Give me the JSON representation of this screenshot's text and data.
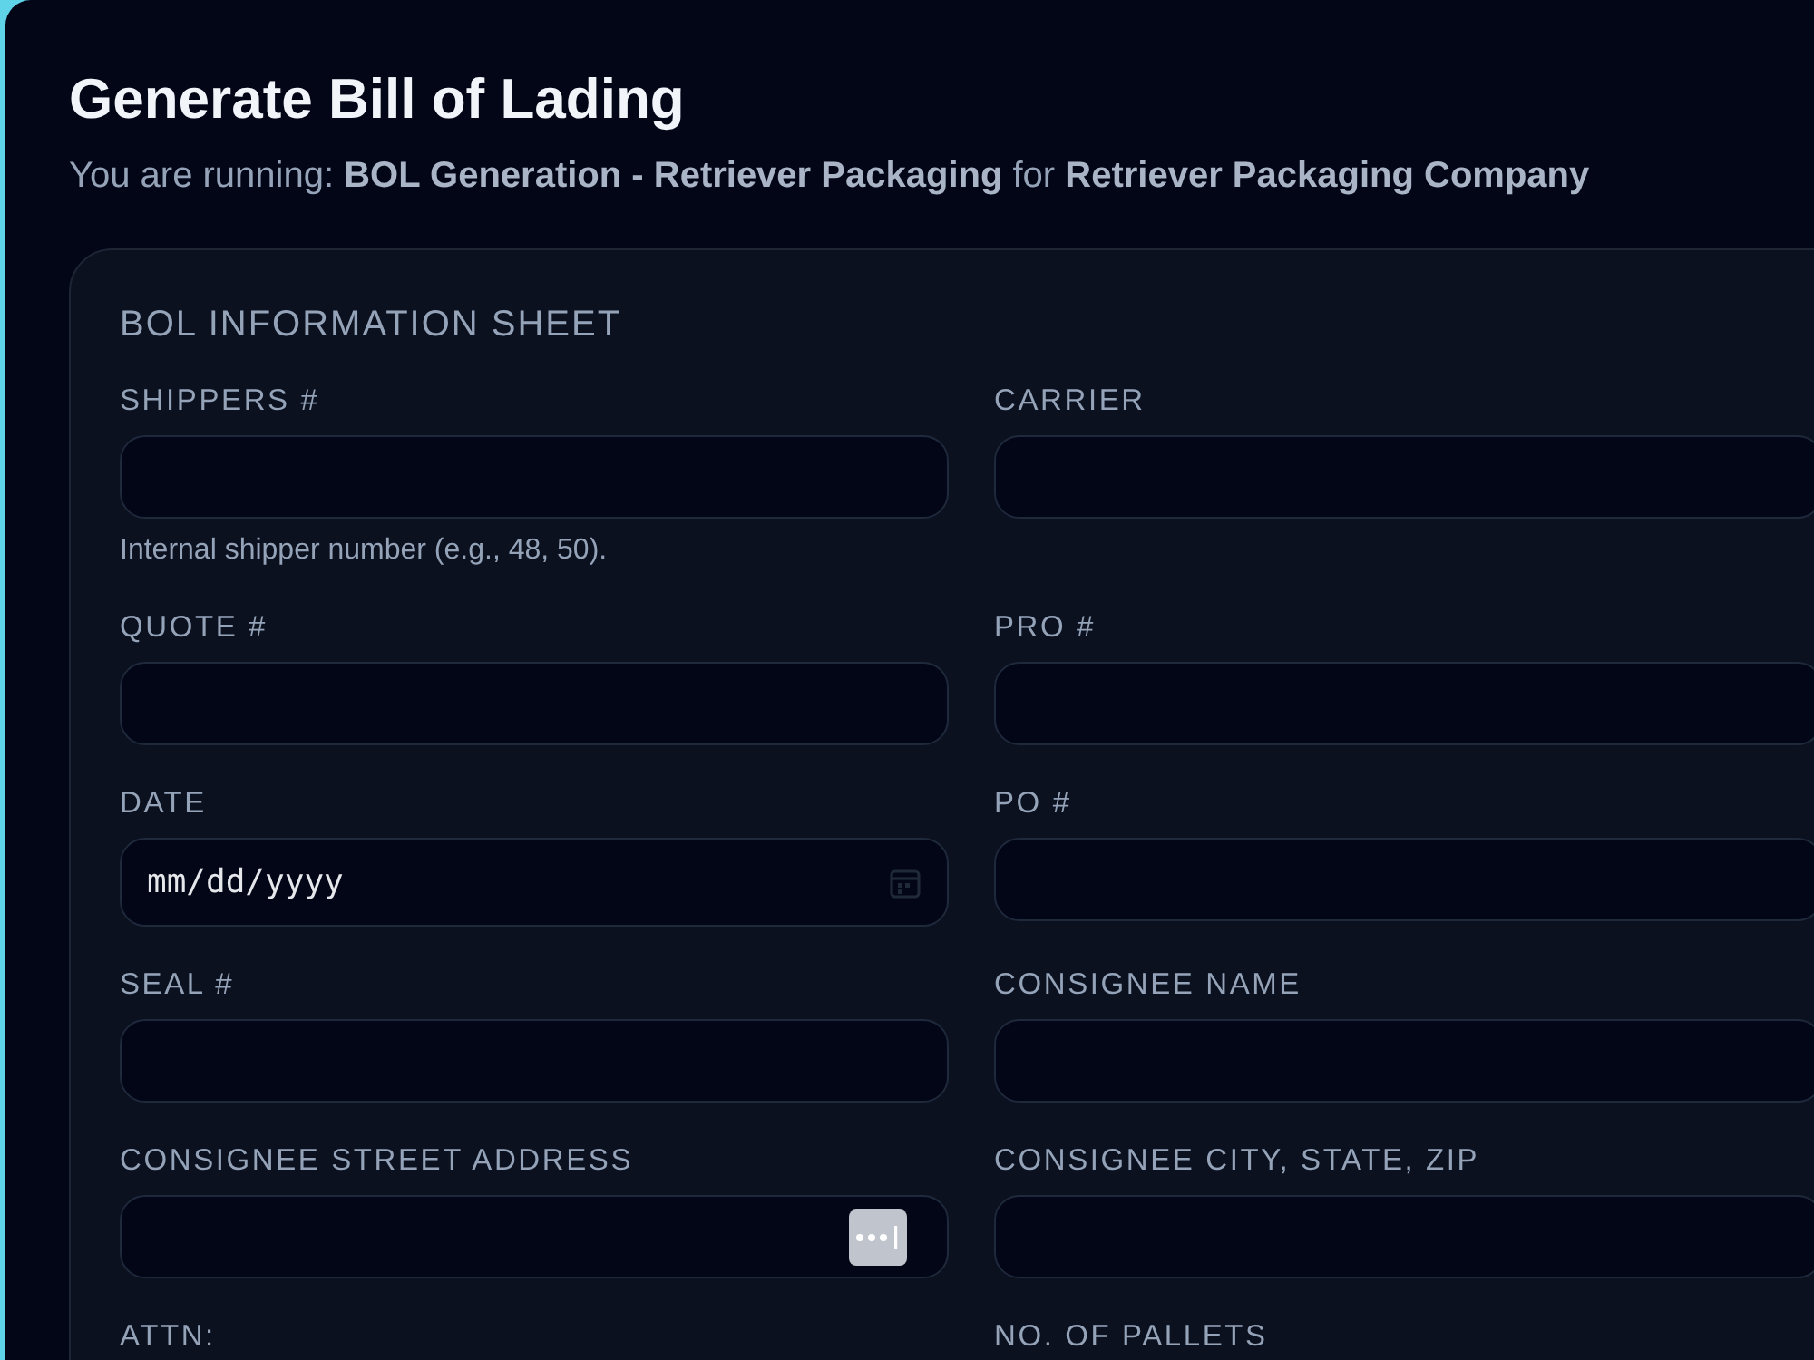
{
  "title": "Generate Bill of Lading",
  "subtitle": "You are running: **BOL Generation - Retriever Packaging** for **Retriever Packaging Company**",
  "sheet": {
    "heading": "BOL INFORMATION SHEET",
    "fields": [
      {
        "label": "SHIPPERS #",
        "kind": "text",
        "hint": "Internal shipper number (e.g., 48, 50)."
      },
      {
        "label": "CARRIER",
        "kind": "text"
      },
      {
        "label": "QUOTE #",
        "kind": "text"
      },
      {
        "label": "PRO #",
        "kind": "text"
      },
      {
        "label": "DATE",
        "kind": "date",
        "placeholder": "mm/dd/yyyy"
      },
      {
        "label": "PO #",
        "kind": "text"
      },
      {
        "label": "SEAL #",
        "kind": "text"
      },
      {
        "label": "CONSIGNEE NAME",
        "kind": "text"
      },
      {
        "label": "CONSIGNEE STREET ADDRESS",
        "kind": "autofill"
      },
      {
        "label": "CONSIGNEE CITY, STATE, ZIP",
        "kind": "text"
      },
      {
        "label": "ATTN:",
        "kind": "label_only"
      },
      {
        "label": "NO. OF PALLETS",
        "kind": "label_only"
      }
    ]
  }
}
